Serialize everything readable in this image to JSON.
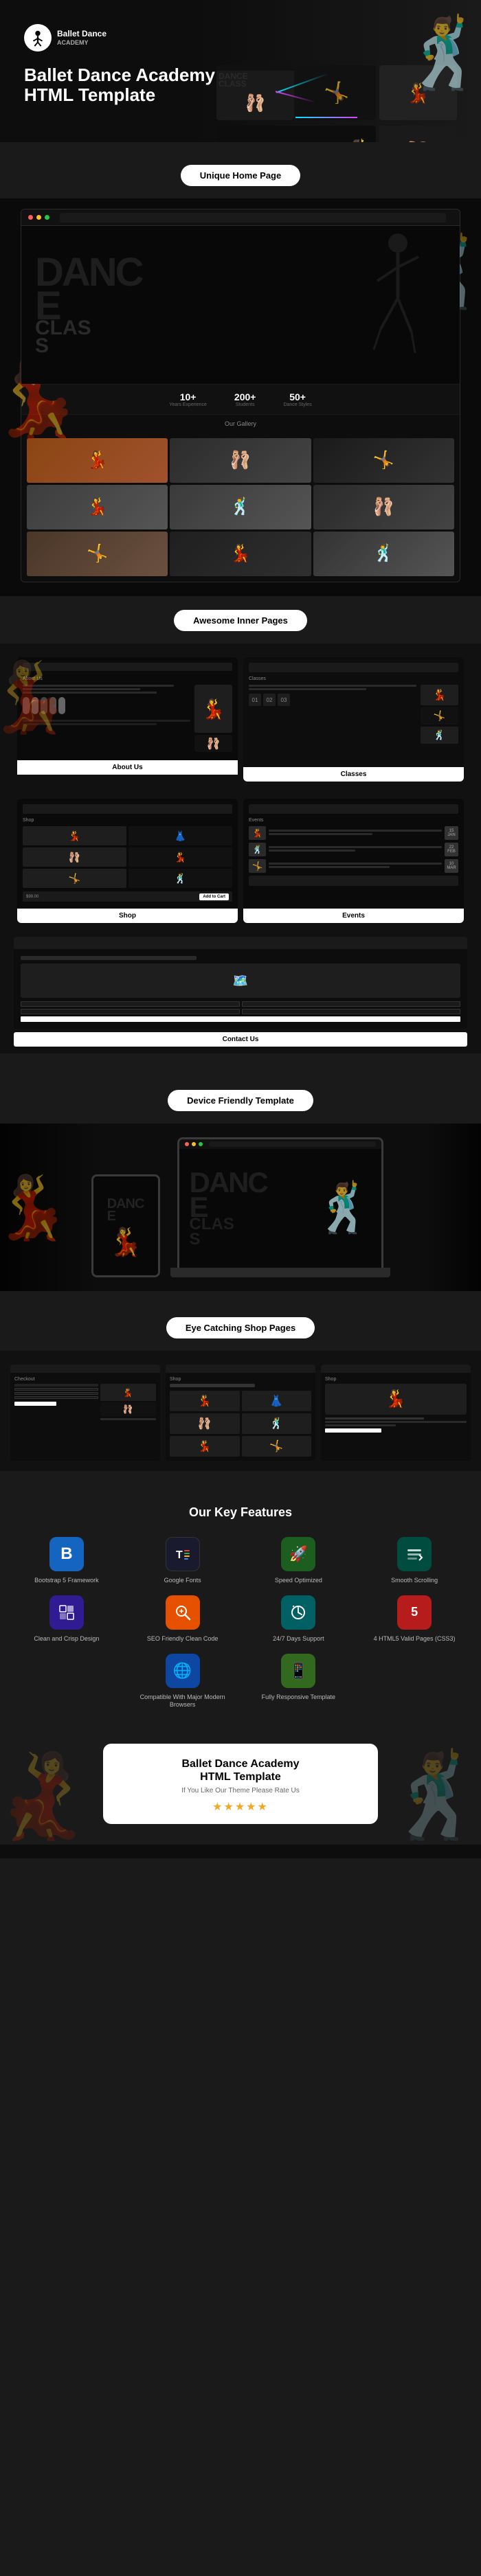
{
  "header": {
    "logo_text_line1": "Ballet Dance",
    "logo_text_line2": "ACADEMY",
    "title_line1": "Ballet Dance Academy",
    "title_line2": "HTML Template"
  },
  "sections": {
    "home_label": "Unique Home Page",
    "inner_pages_label": "Awesome Inner Pages",
    "device_label": "Device Friendly Template",
    "shop_label": "Eye Catching Shop Pages",
    "features_label": "Our Key Features",
    "contact_label": "Contact Us"
  },
  "hero": {
    "dance_text_1": "DANC",
    "dance_text_2": "E",
    "class_text_1": "CLAS",
    "class_text_2": "S",
    "word_dance": "DANCE",
    "word_classes": "CLASSES"
  },
  "stats": [
    {
      "num": "10+",
      "label": "Years Experience"
    },
    {
      "num": "200+",
      "label": "Students"
    },
    {
      "num": "50+",
      "label": "Dance Styles"
    }
  ],
  "gallery_section": {
    "title": "Our Gallery"
  },
  "inner_pages": {
    "about_label": "About Us",
    "classes_label": "Classes",
    "shop_label": "Shop",
    "events_label": "Events",
    "contact_label": "Contact Us"
  },
  "features": {
    "title": "Our Key Features",
    "items": [
      {
        "icon": "B",
        "label": "Bootstrap 5 Framework",
        "color": "fi-blue"
      },
      {
        "icon": "T",
        "label": "Google Fonts",
        "color": "fi-dark"
      },
      {
        "icon": "🚀",
        "label": "Speed Optimized",
        "color": "fi-green"
      },
      {
        "icon": "↕",
        "label": "Smooth Scrolling",
        "color": "fi-teal"
      },
      {
        "icon": "✦",
        "label": "Clean and Crisp Design",
        "color": "fi-purple"
      },
      {
        "icon": "≡",
        "label": "SEO Friendly Clean Code",
        "color": "fi-orange"
      },
      {
        "icon": "⟳",
        "label": "24/7 Days Support",
        "color": "fi-cyan"
      },
      {
        "icon": "5",
        "label": "4 HTML5 Valid Pages (CSS3)",
        "color": "fi-red"
      },
      {
        "icon": "🌐",
        "label": "Compatible With Major Modern Browsers",
        "color": "fi-blue2"
      },
      {
        "icon": "📱",
        "label": "Fully Responsive Template",
        "color": "fi-lime"
      }
    ]
  },
  "footer_card": {
    "title_line1": "Ballet Dance Academy",
    "title_line2": "HTML Template",
    "subtitle": "If You Like Our Theme Please Rate Us",
    "stars": "★★★★★"
  },
  "colors": {
    "accent": "#ffffff",
    "bg_dark": "#0d0d0d",
    "bg_medium": "#111111",
    "bg_light": "#1a1a1a",
    "text_muted": "#888888"
  }
}
